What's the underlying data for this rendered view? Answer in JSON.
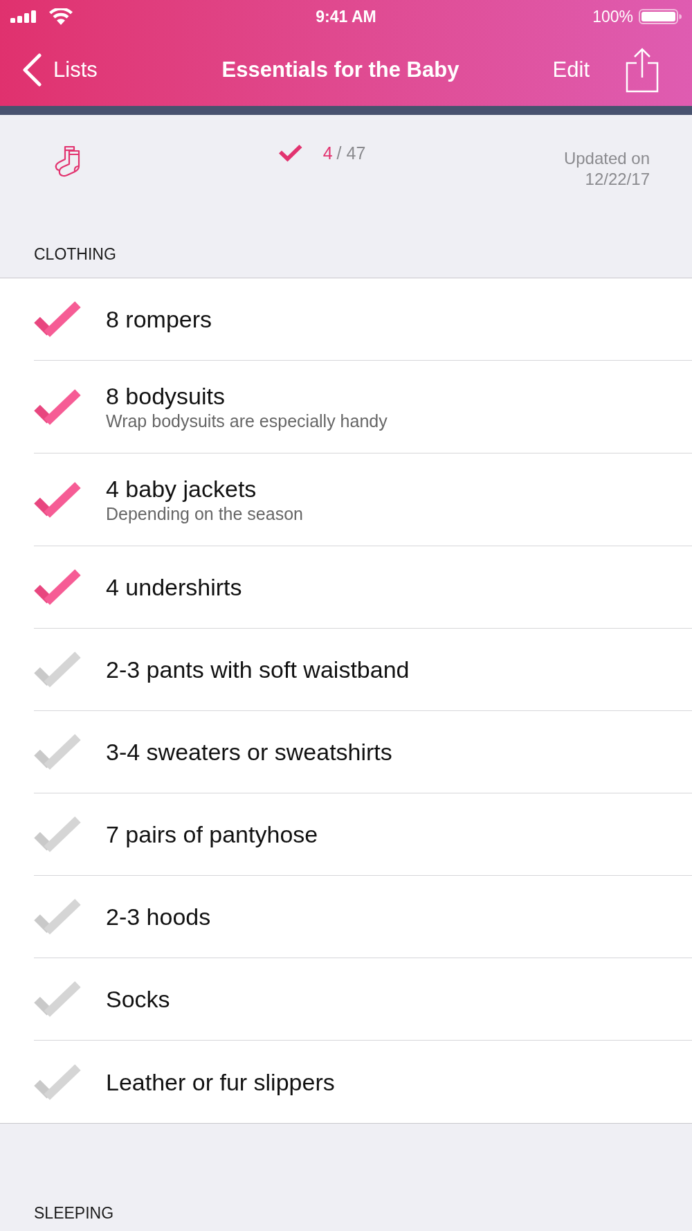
{
  "status_bar": {
    "time": "9:41 AM",
    "battery_percent": "100%"
  },
  "nav_bar": {
    "back_label": "Lists",
    "title": "Essentials for the Baby",
    "edit_label": "Edit"
  },
  "summary": {
    "checked_count": "4",
    "total": "/ 47",
    "updated": "Updated on 12/22/17"
  },
  "sections": [
    {
      "title": "CLOTHING",
      "items": [
        {
          "name": "8 rompers",
          "checked": true
        },
        {
          "name": "8 bodysuits",
          "note": "Wrap bodysuits are especially handy",
          "checked": true
        },
        {
          "name": "4 baby jackets",
          "note": "Depending on the season",
          "checked": true
        },
        {
          "name": "4 undershirts",
          "checked": true
        },
        {
          "name": "2-3 pants with soft waistband",
          "checked": false
        },
        {
          "name": "3-4 sweaters or sweatshirts",
          "checked": false
        },
        {
          "name": "7 pairs of pantyhose",
          "checked": false
        },
        {
          "name": "2-3 hoods",
          "checked": false
        },
        {
          "name": "Socks",
          "checked": false
        },
        {
          "name": "Leather or fur slippers",
          "checked": false
        }
      ]
    },
    {
      "title": "SLEEPING"
    }
  ]
}
